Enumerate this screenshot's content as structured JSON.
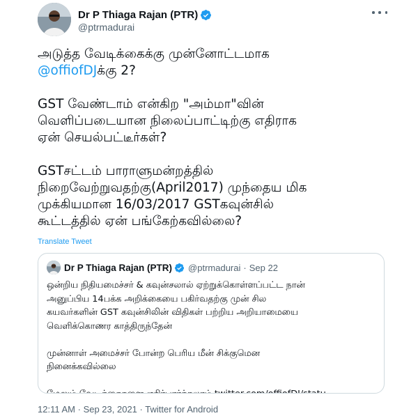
{
  "author": {
    "display_name": "Dr P Thiaga Rajan (PTR)",
    "handle": "@ptrmadurai",
    "avatar_icon": "profile-photo-icon",
    "verified_icon": "verified-badge-icon",
    "verified_color": "#1d9bf0"
  },
  "tweet": {
    "paragraphs": [
      {
        "lines": [
          {
            "text": "அடுத்த வேடிக்கைக்கு முன்னோட்டமாக"
          }
        ],
        "mention_line": {
          "mention": "@offiofDJ",
          "rest": "க்கு 2?"
        }
      },
      {
        "lines": [
          {
            "text": "GST வேண்டாம் என்கிற \"அம்மா\"வின்"
          },
          {
            "text": "வெளிப்படையான நிலைப்பாட்டிற்கு எதிராக"
          },
          {
            "text": "ஏன் செயல்பட்டீர்கள்?"
          }
        ]
      },
      {
        "lines": [
          {
            "text": "GSTசட்டம் பாராளுமன்றத்தில்"
          },
          {
            "text": "நிறைவேற்றுவதற்கு(April2017) முந்தைய மிக"
          },
          {
            "text": "முக்கியமான  16/03/2017 GSTகவுன்சில்"
          },
          {
            "text": "கூட்டத்தில் ஏன் பங்கேற்கவில்லை?"
          }
        ]
      }
    ],
    "translate_label": "Translate Tweet",
    "accent_color": "#1d9bf0"
  },
  "quote": {
    "display_name": "Dr P Thiaga Rajan (PTR)",
    "handle": "@ptrmadurai",
    "separator": "·",
    "time": "Sep 22",
    "paragraphs": [
      [
        "ஒன்றிய நிதியமைச்சர் & கவுன்சலால் ஏற்றுக்கொள்ளப்பட்ட நான்",
        "அனுப்பிய 14பக்க அறிக்கையை பகிர்வதற்கு முன் சில",
        "கயவர்களின் GST கவுன்சிலின் விதிகள் பற்றிய அறியாமையை",
        "வெளிக்கொணர காத்திருந்தேன்"
      ],
      [
        "முன்னாள் அமைச்சர் போன்ற பெரிய மீன் சிக்குமென",
        "நினைக்கவில்லை"
      ],
      [
        "மேலும் வேடிக்கைகளை எதிர்பார்க்கலாம் twitter.com/offiofDJ/statu..."
      ]
    ]
  },
  "meta": {
    "time": "12:11 AM",
    "separator": "·",
    "date": "Sep 23, 2021",
    "source": "Twitter for Android"
  }
}
